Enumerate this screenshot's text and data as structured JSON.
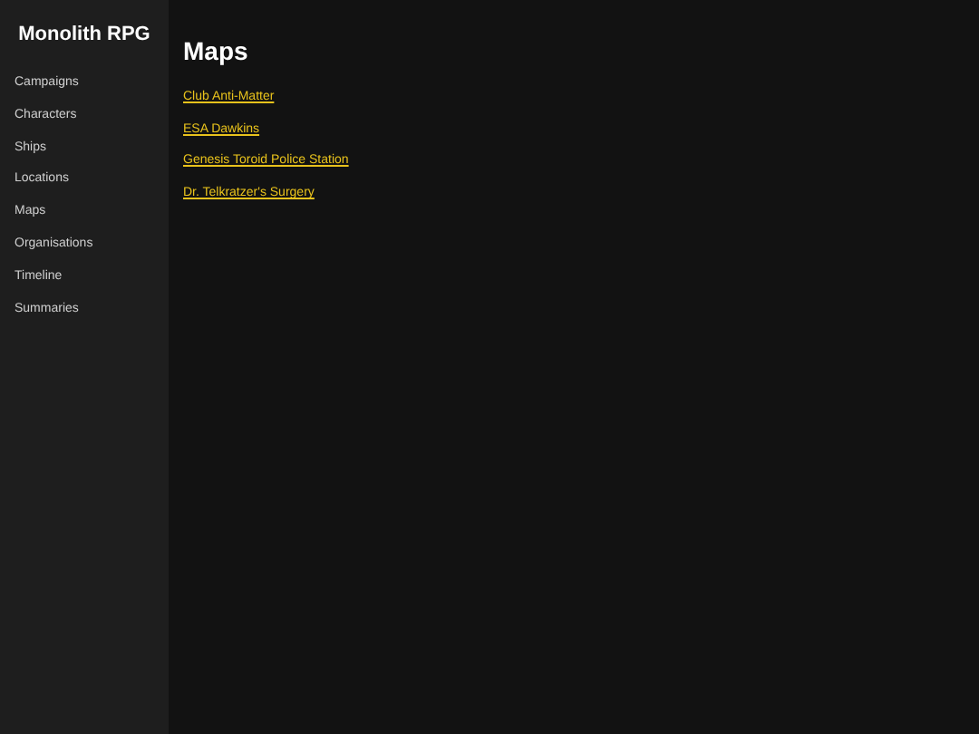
{
  "sidebar": {
    "title": "Monolith RPG",
    "items": [
      "Campaigns",
      "Characters",
      "Ships",
      "Locations",
      "Maps",
      "Organisations",
      "Timeline",
      "Summaries"
    ]
  },
  "main": {
    "heading": "Maps",
    "links": [
      "Club Anti-Matter",
      "ESA Dawkins",
      "Genesis Toroid Police Station",
      "Dr. Telkratzer's Surgery"
    ]
  }
}
